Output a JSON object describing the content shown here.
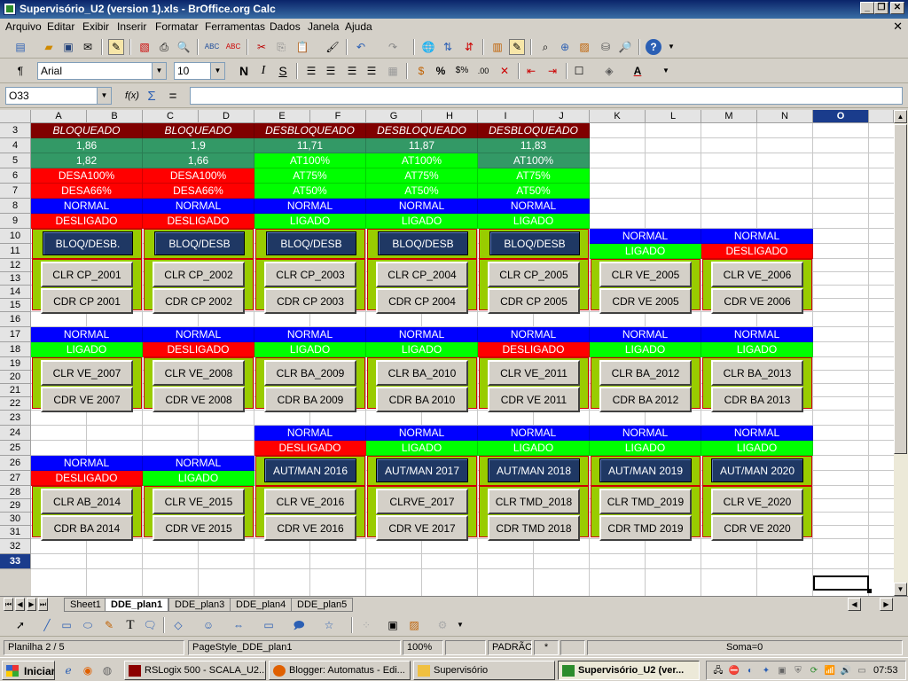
{
  "window": {
    "title": "Supervisório_U2 (version 1).xls - BrOffice.org Calc"
  },
  "menu": [
    "Arquivo",
    "Editar",
    "Exibir",
    "Inserir",
    "Formatar",
    "Ferramentas",
    "Dados",
    "Janela",
    "Ajuda"
  ],
  "format_bar": {
    "font_name": "Arial",
    "font_size": "10"
  },
  "formula_bar": {
    "name_box": "O33",
    "fx": "f(x)",
    "sigma": "Σ",
    "equals": "=",
    "content": ""
  },
  "columns": [
    "A",
    "B",
    "C",
    "D",
    "E",
    "F",
    "G",
    "H",
    "I",
    "J",
    "K",
    "L",
    "M",
    "N",
    "O"
  ],
  "rows": [
    "3",
    "4",
    "5",
    "6",
    "7",
    "8",
    "9",
    "10",
    "11",
    "12",
    "13",
    "14",
    "15",
    "16",
    "17",
    "18",
    "19",
    "20",
    "21",
    "22",
    "23",
    "24",
    "25",
    "26",
    "27",
    "28",
    "29",
    "30",
    "31",
    "32",
    "33"
  ],
  "top_block": {
    "row3": [
      "BLOQUEADO",
      "BLOQUEADO",
      "DESBLOQUEADO",
      "DESBLOQUEADO",
      "DESBLOQUEADO"
    ],
    "row4": [
      "1,86",
      "1,9",
      "11,71",
      "11,87",
      "11,83"
    ],
    "row5": [
      "1,82",
      "1,66",
      "AT100%",
      "AT100%",
      "AT100%"
    ],
    "row6": [
      "DESA100%",
      "DESA100%",
      "AT75%",
      "AT75%",
      "AT75%"
    ],
    "row7": [
      "DESA66%",
      "DESA66%",
      "AT50%",
      "AT50%",
      "AT50%"
    ],
    "row8": [
      "NORMAL",
      "NORMAL",
      "NORMAL",
      "NORMAL",
      "NORMAL"
    ],
    "row9": [
      "DESLIGADO",
      "DESLIGADO",
      "LIGADO",
      "LIGADO",
      "LIGADO"
    ]
  },
  "bloq_buttons": [
    "BLOQ/DESB.",
    "BLOQ/DESB",
    "BLOQ/DESB",
    "BLOQ/DESB",
    "BLOQ/DESB"
  ],
  "row10_11": {
    "r10": [
      "NORMAL",
      "NORMAL"
    ],
    "r11": [
      "LIGADO",
      "DESLIGADO"
    ]
  },
  "panel_row1": {
    "clr": [
      "CLR CP_2001",
      "CLR CP_2002",
      "CLR CP_2003",
      "CLR CP_2004",
      "CLR CP_2005",
      "CLR VE_2005",
      "CLR VE_2006"
    ],
    "cdr": [
      "CDR CP 2001",
      "CDR CP 2002",
      "CDR CP 2003",
      "CDR CP 2004",
      "CDR CP 2005",
      "CDR VE 2005",
      "CDR VE 2006"
    ]
  },
  "row17_18": {
    "r17": [
      "NORMAL",
      "NORMAL",
      "NORMAL",
      "NORMAL",
      "NORMAL",
      "NORMAL",
      "NORMAL"
    ],
    "r18": [
      "LIGADO",
      "DESLIGADO",
      "LIGADO",
      "LIGADO",
      "DESLIGADO",
      "LIGADO",
      "LIGADO"
    ]
  },
  "panel_row2": {
    "clr": [
      "CLR VE_2007",
      "CLR VE_2008",
      "CLR BA_2009",
      "CLR BA_2010",
      "CLR VE_2011",
      "CLR BA_2012",
      "CLR BA_2013"
    ],
    "cdr": [
      "CDR VE 2007",
      "CDR VE 2008",
      "CDR BA 2009",
      "CDR BA 2010",
      "CDR VE 2011",
      "CDR BA 2012",
      "CDR BA 2013"
    ]
  },
  "row24_25": {
    "r24": [
      "NORMAL",
      "NORMAL",
      "NORMAL",
      "NORMAL",
      "NORMAL"
    ],
    "r25": [
      "DESLIGADO",
      "LIGADO",
      "LIGADO",
      "LIGADO",
      "LIGADO"
    ]
  },
  "row26_27": {
    "r26": [
      "NORMAL",
      "NORMAL"
    ],
    "r27": [
      "DESLIGADO",
      "LIGADO"
    ]
  },
  "autman_buttons": [
    "AUT/MAN 2016",
    "AUT/MAN 2017",
    "AUT/MAN 2018",
    "AUT/MAN 2019",
    "AUT/MAN 2020"
  ],
  "panel_row3": {
    "clr": [
      "CLR AB_2014",
      "CLR VE_2015",
      "CLR VE_2016",
      "CLRVE_2017",
      "CLR TMD_2018",
      "CLR TMD_2019",
      "CLR VE_2020"
    ],
    "cdr": [
      "CDR BA 2014",
      "CDR VE 2015",
      "CDR VE 2016",
      "CDR VE 2017",
      "CDR TMD 2018",
      "CDR TMD 2019",
      "CDR VE 2020"
    ]
  },
  "sheet_tabs": [
    "Sheet1",
    "DDE_plan1",
    "DDE_plan3",
    "DDE_plan4",
    "DDE_plan5"
  ],
  "active_sheet": "DDE_plan1",
  "status": {
    "sheet": "Planilha 2 / 5",
    "style": "PageStyle_DDE_plan1",
    "zoom": "100%",
    "mode": "PADRÃO",
    "star": "*",
    "sum": "Soma=0"
  },
  "taskbar": {
    "start": "Iniciar",
    "tasks": [
      "RSLogix 500 - SCALA_U2...",
      "Blogger: Automatus - Edi...",
      "Supervisório",
      "Supervisório_U2 (ver..."
    ],
    "clock": "07:53"
  },
  "colors": {
    "maroon": "#800000",
    "teal": "#339966",
    "green": "#00ff00",
    "red": "#ff0000",
    "blue": "#0000ff",
    "panel": "#99cc00",
    "dark_button": "#1f3864"
  }
}
